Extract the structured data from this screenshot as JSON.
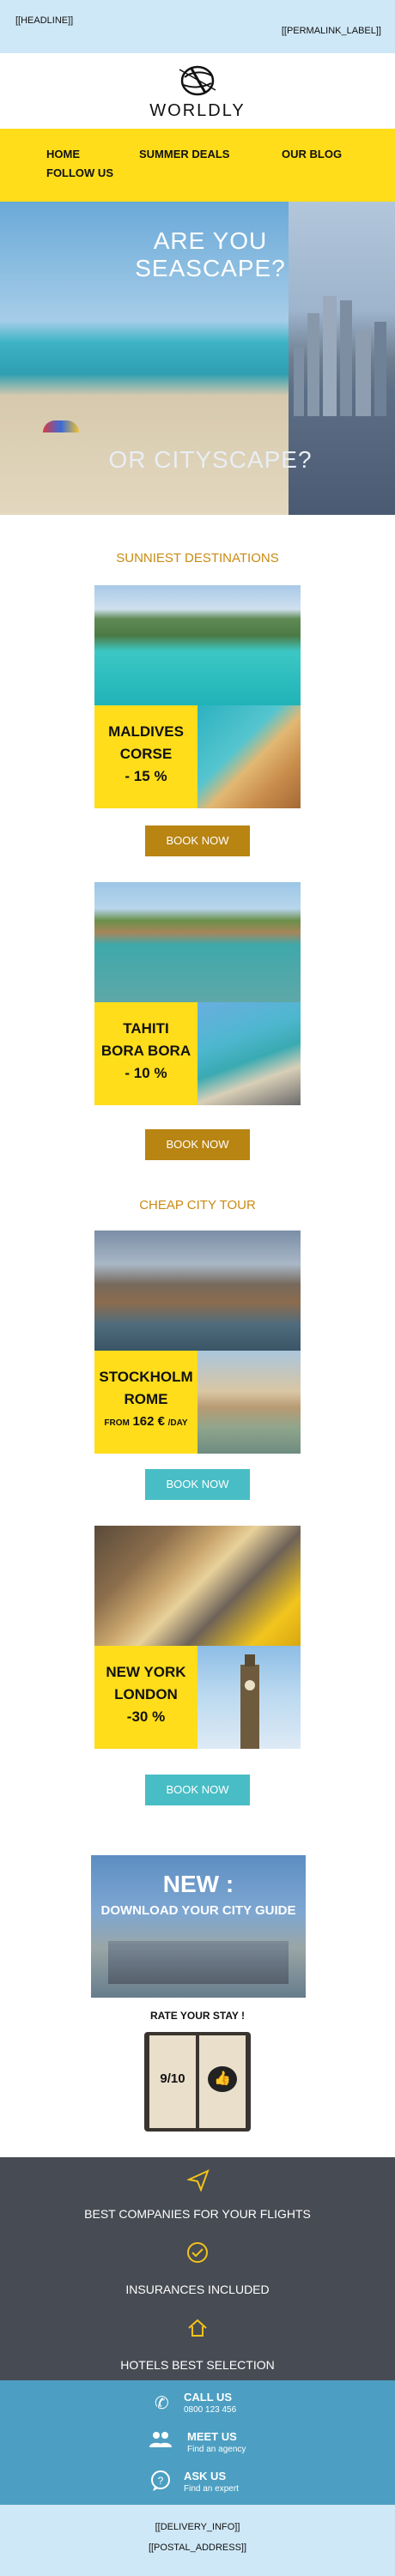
{
  "header": {
    "headline": "[[HEADLINE]]",
    "permalink": "[[PERMALINK_LABEL]]",
    "brand": "WORLDLY"
  },
  "nav": {
    "items": [
      "HOME",
      "SUMMER DEALS",
      "OUR BLOG",
      "FOLLOW US"
    ]
  },
  "hero": {
    "top_text": "ARE YOU SEASCAPE?",
    "bottom_text": "OR CITYSCAPE?"
  },
  "sections": {
    "sunniest": "SUNNIEST DESTINATIONS",
    "city": "CHEAP CITY TOUR"
  },
  "cards": [
    {
      "line1": "MALDIVES",
      "line2": "CORSE",
      "line3": "- 15 %",
      "button": "BOOK NOW"
    },
    {
      "line1": "TAHITI",
      "line2": "BORA BORA",
      "line3": "- 10 %",
      "button": "BOOK NOW"
    },
    {
      "line1": "STOCKHOLM",
      "line2": "ROME",
      "line3_prefix": "FROM",
      "line3_price": "162 €",
      "line3_suffix": "/DAY",
      "button": "BOOK NOW"
    },
    {
      "line1": "NEW YORK",
      "line2": "LONDON",
      "line3": "-30 %",
      "button": "BOOK NOW"
    }
  ],
  "promo": {
    "new": "NEW :",
    "guide": "DOWNLOAD YOUR CITY GUIDE",
    "rate": "RATE YOUR STAY !",
    "score": "9/10"
  },
  "features": [
    {
      "icon": "paper-plane-icon",
      "text": "BEST COMPANIES FOR YOUR FLIGHTS"
    },
    {
      "icon": "check-circle-icon",
      "text": "INSURANCES INCLUDED"
    },
    {
      "icon": "home-icon",
      "text": "HOTELS BEST SELECTION"
    }
  ],
  "contacts": [
    {
      "icon": "phone-icon",
      "label": "CALL US",
      "sub": "0800 123 456"
    },
    {
      "icon": "people-icon",
      "label": "MEET US",
      "sub": "Find an agency"
    },
    {
      "icon": "chat-icon",
      "label": "ASK US",
      "sub": "Find an expert"
    }
  ],
  "footer": {
    "delivery": "[[DELIVERY_INFO]]",
    "postal": "[[POSTAL_ADDRESS]]"
  },
  "colors": {
    "accent_yellow": "#ffdd1a",
    "button_gold": "#b88412",
    "button_teal": "#48bdc5",
    "section_title": "#c98a12",
    "dark_band": "#474b53",
    "contact_band": "#4c9fc2",
    "light_band": "#cfe8f7"
  }
}
